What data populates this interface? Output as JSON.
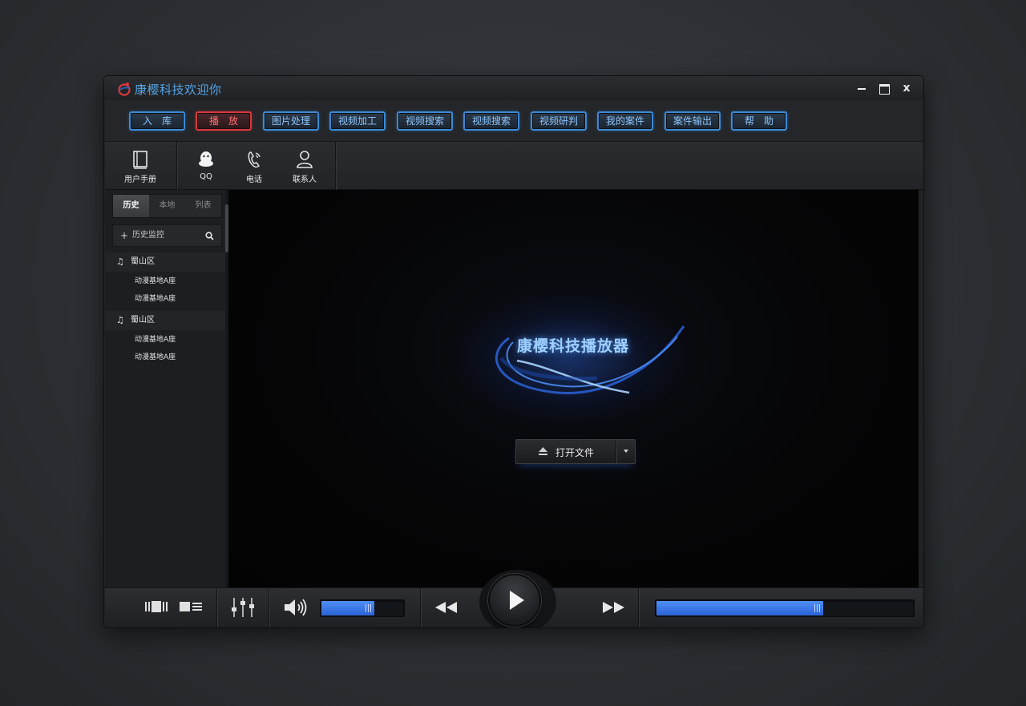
{
  "window": {
    "title": "康樱科技欢迎你",
    "close_glyph": "x"
  },
  "menu": [
    {
      "label": "入　库",
      "active": false
    },
    {
      "label": "播　放",
      "active": true
    },
    {
      "label": "图片处理",
      "active": false
    },
    {
      "label": "视频加工",
      "active": false
    },
    {
      "label": "视频搜索",
      "active": false
    },
    {
      "label": "视频搜索",
      "active": false
    },
    {
      "label": "视频研判",
      "active": false
    },
    {
      "label": "我的案件",
      "active": false
    },
    {
      "label": "案件输出",
      "active": false
    },
    {
      "label": "帮　助",
      "active": false
    }
  ],
  "toolbar": {
    "manual": {
      "label": "用户手册",
      "icon": "book-icon"
    },
    "qq": {
      "label": "QQ",
      "icon": "qq-penguin-icon"
    },
    "phone": {
      "label": "电话",
      "icon": "phone-icon"
    },
    "contacts": {
      "label": "联系人",
      "icon": "person-icon"
    }
  },
  "sidebar": {
    "tabs": [
      {
        "label": "历史",
        "active": true
      },
      {
        "label": "本地",
        "active": false
      },
      {
        "label": "列表",
        "active": false
      }
    ],
    "search": {
      "plus": "+",
      "label": "历史监控",
      "icon": "search-icon"
    },
    "groups": [
      {
        "label": "蜀山区",
        "icon": "music-note-icon",
        "items": [
          "动漫基地A座",
          "动漫基地A座"
        ]
      },
      {
        "label": "蜀山区",
        "icon": "music-note-icon",
        "items": [
          "动漫基地A座",
          "动漫基地A座"
        ]
      }
    ]
  },
  "player": {
    "brand": "康樱科技播放器",
    "open_file": "打开文件"
  },
  "controls": {
    "volume_level": 0.65,
    "progress": 0.65,
    "accent": "#3f7ff0"
  },
  "colors": {
    "menu_border": "#3c8ad6",
    "menu_active_border": "#d8393e",
    "title_text": "#56a4e4"
  }
}
